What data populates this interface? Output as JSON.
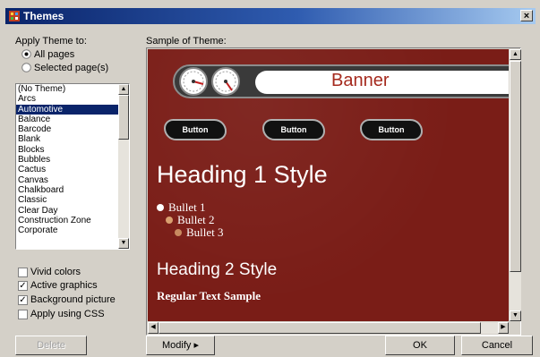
{
  "window": {
    "title": "Themes",
    "close_glyph": "×"
  },
  "apply_group": {
    "label": "Apply Theme to:",
    "options": [
      {
        "label": "All pages",
        "selected": true
      },
      {
        "label": "Selected page(s)",
        "selected": false
      }
    ]
  },
  "theme_list": {
    "items": [
      "(No Theme)",
      "Arcs",
      "Automotive",
      "Balance",
      "Barcode",
      "Blank",
      "Blocks",
      "Bubbles",
      "Cactus",
      "Canvas",
      "Chalkboard",
      "Classic",
      "Clear Day",
      "Construction Zone",
      "Corporate"
    ],
    "selected_index": 2
  },
  "options": [
    {
      "label": "Vivid colors",
      "checked": false
    },
    {
      "label": "Active graphics",
      "checked": true
    },
    {
      "label": "Background picture",
      "checked": true
    },
    {
      "label": "Apply using CSS",
      "checked": false
    }
  ],
  "sample": {
    "label": "Sample of Theme:",
    "banner_text": "Banner",
    "buttons": [
      "Button",
      "Button",
      "Button"
    ],
    "heading1": "Heading 1 Style",
    "bullets": [
      "Bullet 1",
      "Bullet 2",
      "Bullet 3"
    ],
    "heading2": "Heading 2 Style",
    "regular_text": "Regular Text Sample"
  },
  "buttons": {
    "delete": "Delete",
    "modify": "Modify ▸",
    "ok": "OK",
    "cancel": "Cancel"
  },
  "scroll_glyphs": {
    "up": "▲",
    "down": "▼",
    "left": "◀",
    "right": "▶"
  },
  "colors": {
    "title_bar": "#0a246a",
    "selection": "#0a246a",
    "theme_background": "#7a1d17",
    "banner_text": "#a52a1e"
  }
}
